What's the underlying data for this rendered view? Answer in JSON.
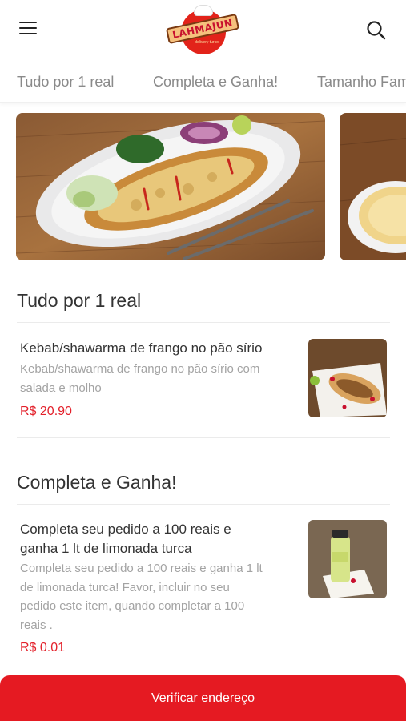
{
  "header": {
    "logo_text": "LAHMAJUN",
    "logo_subtext": "delivery turco"
  },
  "tabs": [
    {
      "label": "Tudo por 1 real"
    },
    {
      "label": "Completa e Ganha!"
    },
    {
      "label": "Tamanho Fam"
    }
  ],
  "sections": [
    {
      "title": "Tudo por 1 real",
      "items": [
        {
          "name": "Kebab/shawarma de frango no pão sírio",
          "description_lines": [
            "Kebab/shawarma de frango no pão sírio com",
            "salada e molho"
          ],
          "price": "R$ 20.90"
        }
      ]
    },
    {
      "title": "Completa e Ganha!",
      "items": [
        {
          "name_lines": [
            "Completa seu pedido a 100 reais e",
            "ganha 1 lt de limonada turca"
          ],
          "description_lines": [
            "Completa seu pedido a 100 reais e ganha 1 lt",
            "de limonada turca! Favor, incluir no seu",
            "pedido este item, quando completar a 100",
            "reais ."
          ],
          "price": "R$ 0.01"
        }
      ]
    }
  ],
  "cta": {
    "label": "Verificar endereço"
  },
  "colors": {
    "accent": "#e51a22",
    "price": "#e3212b",
    "tab_text": "#8a8a8a",
    "desc_text": "#a3a3a3"
  },
  "icons": [
    "hamburger-menu-icon",
    "search-icon"
  ]
}
